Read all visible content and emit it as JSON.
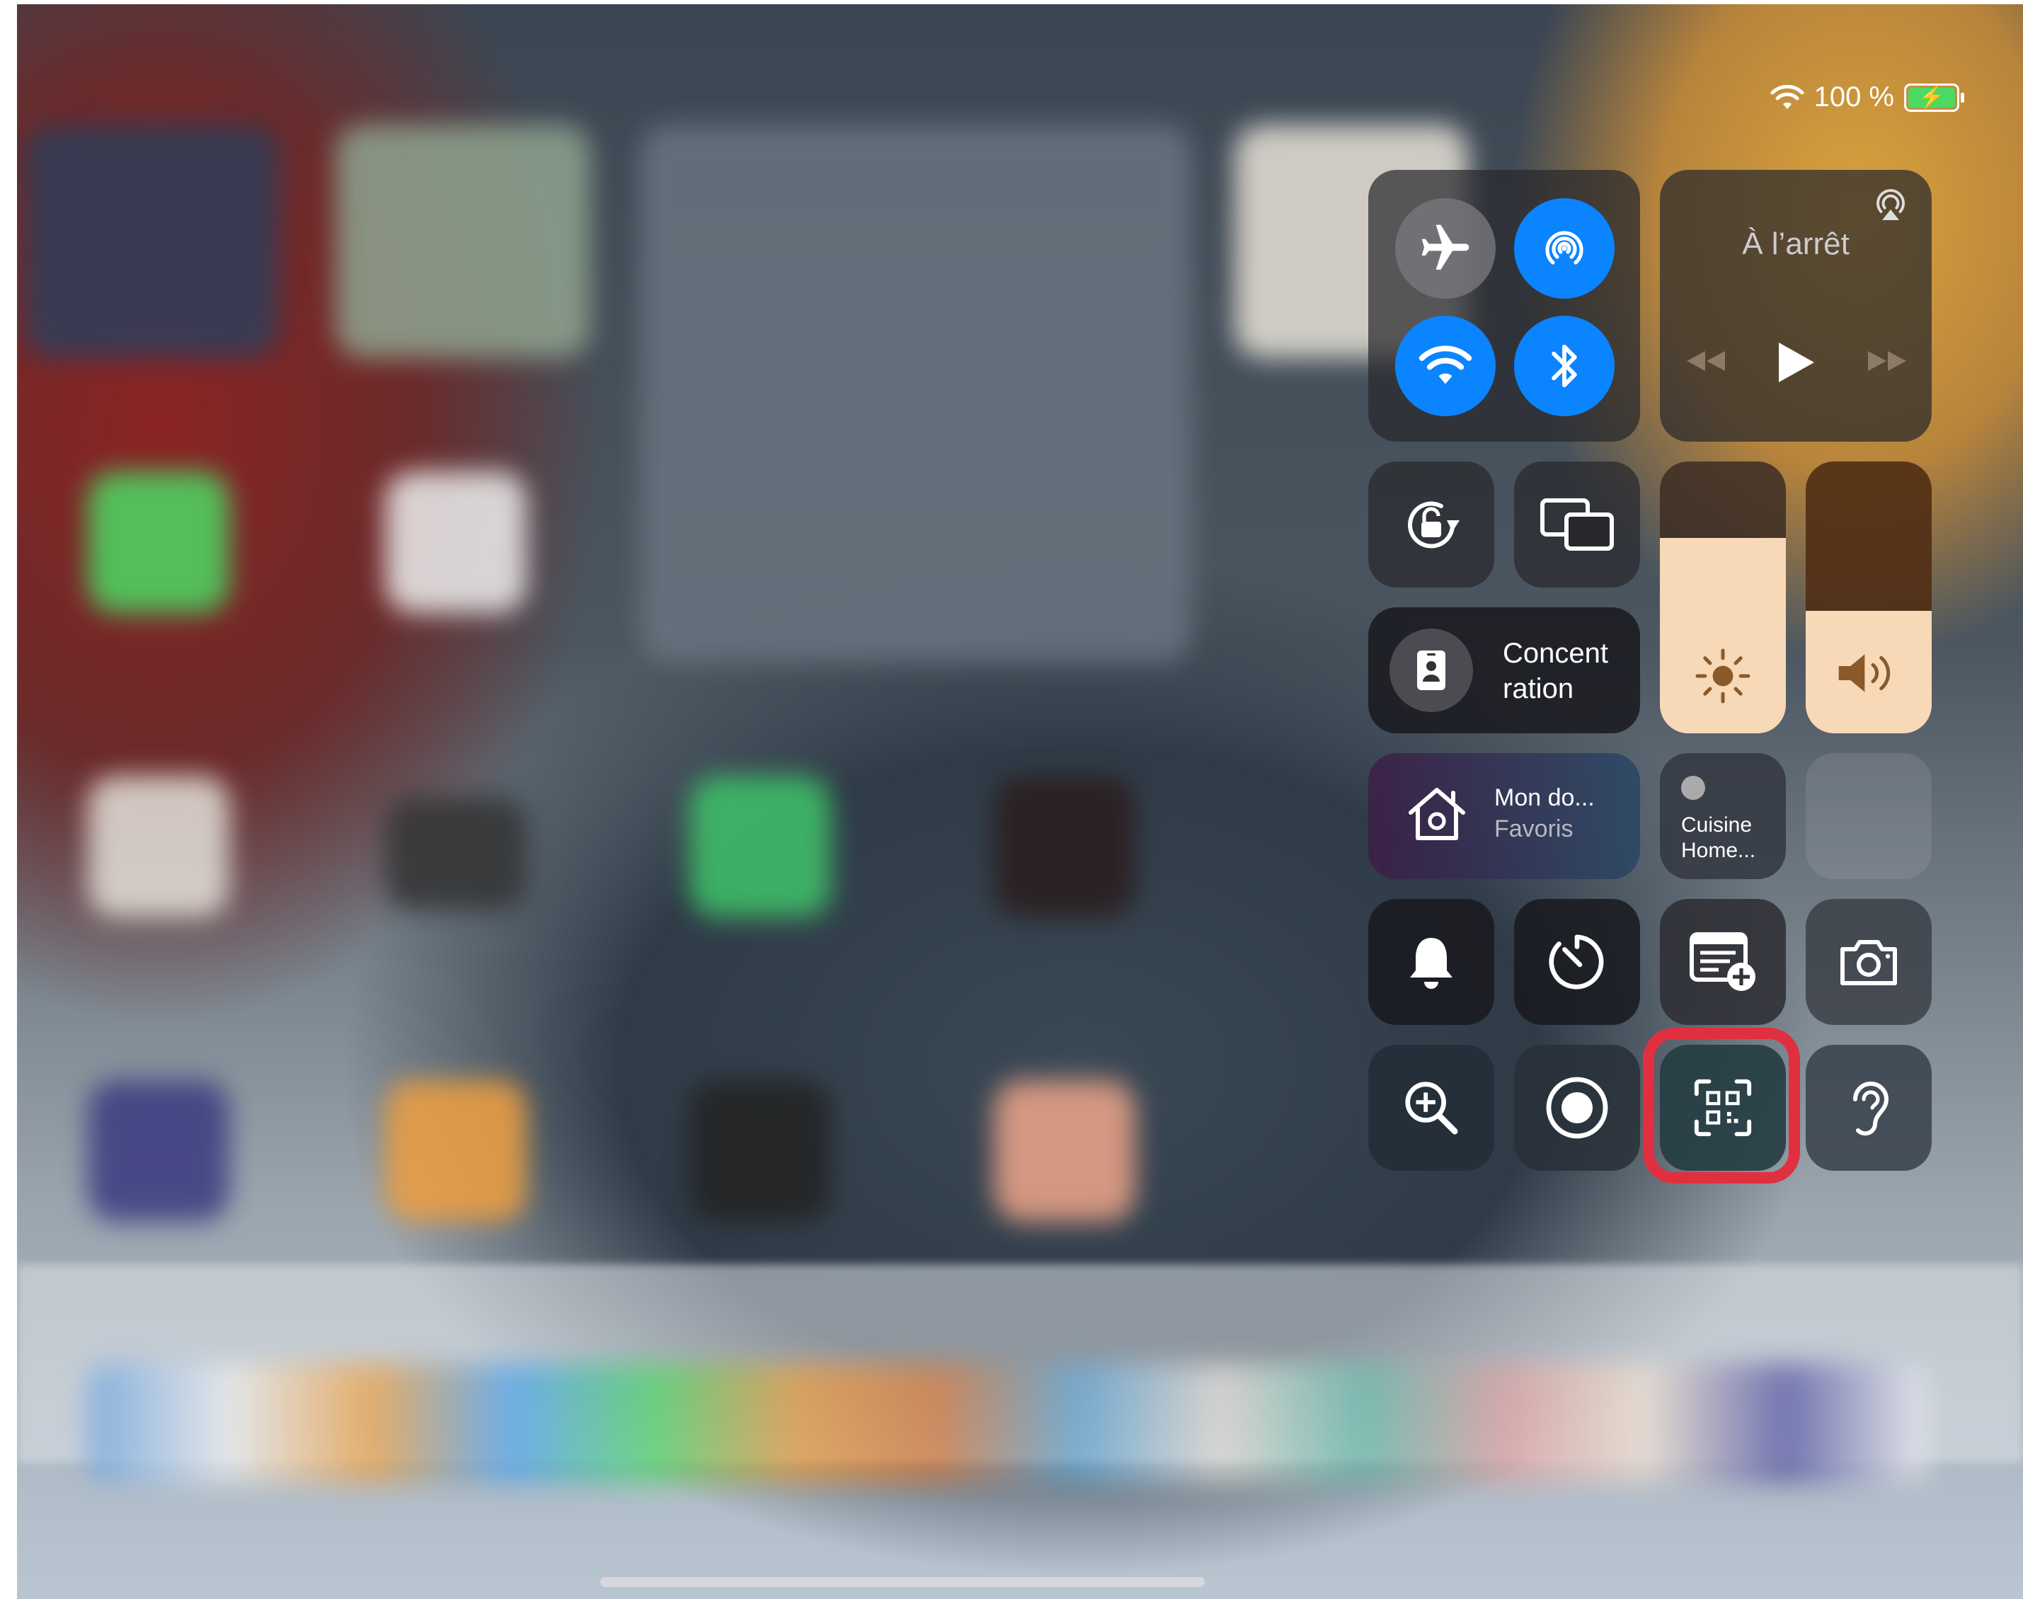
{
  "status_bar": {
    "battery_percent": "100 %"
  },
  "now_playing": {
    "state": "À l’arrêt"
  },
  "focus": {
    "label_line1": "Concent",
    "label_line2": "ration"
  },
  "home": {
    "title": "Mon do...",
    "subtitle": "Favoris"
  },
  "accessory": {
    "line1": "Cuisine",
    "line2": "Home..."
  },
  "sliders": {
    "brightness_level": 0.72,
    "volume_level": 0.45
  },
  "colors": {
    "accent_blue": "#0a84ff",
    "highlight_red": "#e0303f",
    "slider_fill": "#f7d9b8"
  }
}
